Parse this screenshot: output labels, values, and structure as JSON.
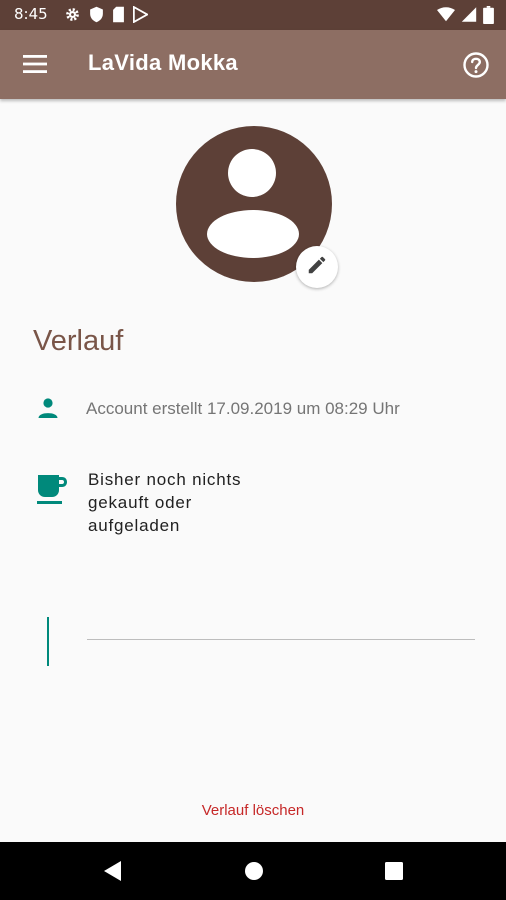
{
  "status_bar": {
    "time": "8:45",
    "left_icons": [
      "settings-icon",
      "shield-icon",
      "sim-card-icon",
      "play-store-icon"
    ],
    "right_icons": [
      "wifi-icon",
      "signal-icon",
      "battery-icon"
    ]
  },
  "app_bar": {
    "title": "LaVida Mokka",
    "menu_icon": "hamburger-menu-icon",
    "help_icon": "help-circle-icon",
    "color": "#8d6e63"
  },
  "profile": {
    "avatar_icon": "account-circle-icon",
    "edit_icon": "pencil-icon",
    "avatar_color": "#5d4037"
  },
  "history": {
    "title": "Verlauf",
    "entries": [
      {
        "icon": "person-icon",
        "text": "Account erstellt 17.09.2019 um 08:29 Uhr"
      },
      {
        "icon": "coffee-cup-icon",
        "text": "Bisher noch nichts gekauft oder aufgeladen"
      }
    ]
  },
  "input": {
    "value": "",
    "placeholder": ""
  },
  "clear_button": {
    "label": "Verlauf löschen",
    "color": "#c62828"
  },
  "accent_color": "#00897b",
  "nav_bar": {
    "buttons": [
      "back-icon",
      "home-icon",
      "recents-icon"
    ]
  }
}
